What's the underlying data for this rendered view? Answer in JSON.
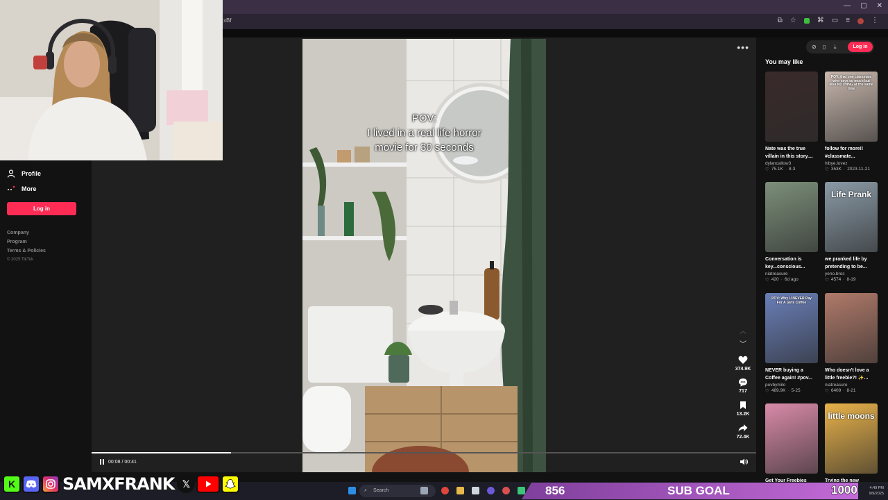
{
  "browser": {
    "url_fragment": "xBf",
    "window_controls": [
      "—",
      "▢",
      "✕"
    ]
  },
  "sidebar": {
    "items": [
      {
        "label": "Profile",
        "icon": "person-icon"
      },
      {
        "label": "More",
        "icon": "more-dots-icon"
      }
    ],
    "login_label": "Log in",
    "footer_links": [
      "Company",
      "Program",
      "Terms & Policies"
    ],
    "copyright": "© 2025 TikTok"
  },
  "player": {
    "caption_lines": [
      "POV:",
      "I lived in a real life horror",
      "movie for 30 seconds"
    ],
    "time_display": "00:08 / 00:41",
    "progress_fraction": 0.21,
    "actions": [
      {
        "icon": "heart-icon",
        "count": "374.9K"
      },
      {
        "icon": "comment-icon",
        "count": "717"
      },
      {
        "icon": "bookmark-icon",
        "count": "13.2K"
      },
      {
        "icon": "share-icon",
        "count": "72.4K"
      }
    ]
  },
  "right": {
    "login_label": "Log in",
    "heading": "You may like",
    "cards": [
      {
        "title": "Nate was the true villain in this story....",
        "author": "dylancallow3",
        "likes": "75.1K",
        "date": "8-3",
        "thumb_color": "#3a2a2a"
      },
      {
        "title": "follow for more!! #classmate...",
        "author": "hibye.lovez",
        "likes": "353K",
        "date": "2023-11-21",
        "thumb_color": "#c9b8ae",
        "overlay": "POV: that one classmate who says so much but also NOTHING at the same time"
      },
      {
        "title": "Conversation is key...conscious...",
        "author": "niatreasure",
        "likes": "420",
        "date": "6d ago",
        "thumb_color": "#7c8f7a"
      },
      {
        "title": "we pranked life by pretending to be...",
        "author": "yeno.bros",
        "likes": "4574",
        "date": "8-19",
        "thumb_color": "#8a9aa6",
        "overlay": "Life Prank"
      },
      {
        "title": "NEVER buying a Coffee again! #pov...",
        "author": "povbymilo",
        "likes": "489.9K",
        "date": "5-25",
        "thumb_color": "#6a7fb8",
        "overlay": "POV: Why U NEVER Pay For A Girls Coffee"
      },
      {
        "title": "Who doesn't love a little freebie?! ✨...",
        "author": "niatreasure",
        "likes": "6409",
        "date": "8-21",
        "thumb_color": "#b07a6a"
      },
      {
        "title": "Get Your Freebies",
        "author": "",
        "likes": "",
        "date": "",
        "thumb_color": "#d98aa8"
      },
      {
        "title": "Trying the new",
        "author": "",
        "likes": "",
        "date": "",
        "thumb_color": "#e8b24a",
        "overlay": "little moons"
      }
    ]
  },
  "overlay": {
    "handle": "SAMXFRANK",
    "social_letters": [
      "K",
      "",
      "",
      "",
      "",
      ""
    ],
    "sub_count": "856",
    "sub_label": "SUB GOAL",
    "sub_target": "1000"
  },
  "taskbar": {
    "search_placeholder": "Search",
    "clock_time": "4:49 PM",
    "clock_date": "9/9/2025"
  }
}
